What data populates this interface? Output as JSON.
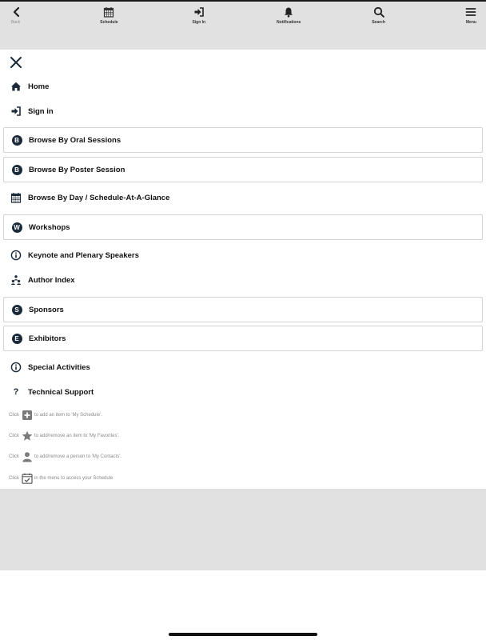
{
  "topbar": {
    "tabs": [
      {
        "label": "Back",
        "icon": "chevron-left-icon"
      },
      {
        "label": "Schedule",
        "icon": "calendar-icon"
      },
      {
        "label": "Sign In",
        "icon": "sign-in-icon"
      },
      {
        "label": "Notifications",
        "icon": "bell-icon"
      },
      {
        "label": "Search",
        "icon": "search-icon"
      },
      {
        "label": "Menu",
        "icon": "hamburger-menu-icon"
      }
    ]
  },
  "menu": {
    "close_icon": "close-icon",
    "items": [
      {
        "label": "Home",
        "icon": "home-icon"
      },
      {
        "label": "Sign in",
        "icon": "sign-in-icon"
      },
      {
        "label": "Browse By Oral Sessions",
        "badge": "B"
      },
      {
        "label": "Browse By Poster Session",
        "badge": "B"
      },
      {
        "label": "Browse By Day / Schedule-At-A-Glance",
        "icon": "calendar-icon"
      },
      {
        "label": "Workshops",
        "badge": "W"
      },
      {
        "label": "Keynote and Plenary Speakers",
        "icon": "info-icon"
      },
      {
        "label": "Author Index",
        "icon": "people-icon"
      },
      {
        "label": "Sponsors",
        "badge": "S"
      },
      {
        "label": "Exhibitors",
        "badge": "E"
      },
      {
        "label": "Special Activities",
        "icon": "info-icon"
      },
      {
        "label": "Technical Support",
        "icon": "question-icon"
      }
    ],
    "hints": [
      {
        "prefix": "Click",
        "suffix": "to add an item to 'My Schedule'.",
        "icon": "plus-square-icon"
      },
      {
        "prefix": "Click",
        "suffix": "to add/remove an item to 'My Favorites'.",
        "icon": "star-icon"
      },
      {
        "prefix": "Click",
        "suffix": "to add/remove a person to 'My Contacts'.",
        "icon": "person-icon"
      },
      {
        "prefix": "Click",
        "suffix": "in the menu to access your Schedule",
        "icon": "calendar-check-icon"
      }
    ]
  },
  "colors": {
    "topbar_bg": "#e1e1e1",
    "badge_bg": "#1b2a3a",
    "border": "#d4d4d4",
    "hint_text": "#8a8a8a"
  }
}
